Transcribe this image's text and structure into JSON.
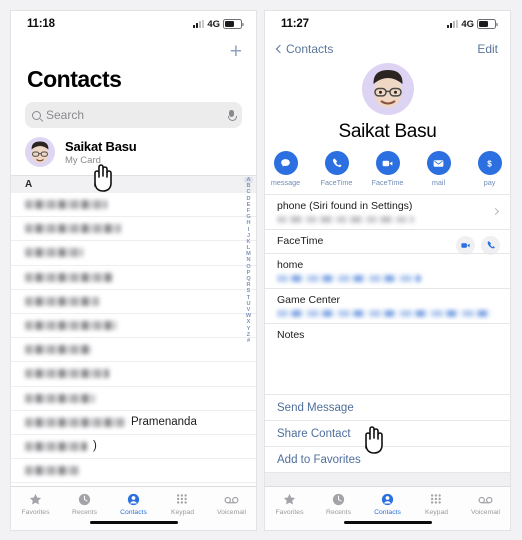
{
  "left": {
    "status": {
      "time": "11:18",
      "network": "4G",
      "signal_icon": "signal-bars-icon",
      "battery_icon": "battery-icon"
    },
    "add_button": "+",
    "title": "Contacts",
    "search": {
      "placeholder": "Search",
      "search_icon": "search-icon",
      "dictation_icon": "microphone-icon"
    },
    "my_card": {
      "name": "Saikat Basu",
      "subtitle": "My Card",
      "avatar_icon": "memoji-avatar"
    },
    "section_header": "A",
    "visible_contact_name": "Pramenanda",
    "redacted_rows": 13,
    "index": [
      "A",
      "B",
      "C",
      "D",
      "E",
      "F",
      "G",
      "H",
      "I",
      "J",
      "K",
      "L",
      "M",
      "N",
      "O",
      "P",
      "Q",
      "R",
      "S",
      "T",
      "U",
      "V",
      "W",
      "X",
      "Y",
      "Z",
      "#"
    ]
  },
  "right": {
    "status": {
      "time": "11:27",
      "network": "4G",
      "signal_icon": "signal-bars-icon",
      "battery_icon": "battery-icon"
    },
    "back_label": "Contacts",
    "back_icon": "chevron-left-icon",
    "edit_label": "Edit",
    "contact_name": "Saikat Basu",
    "avatar_icon": "memoji-avatar",
    "actions": [
      {
        "label": "message",
        "icon": "message-bubble-icon"
      },
      {
        "label": "FaceTime",
        "icon": "phone-icon"
      },
      {
        "label": "FaceTime",
        "icon": "video-camera-icon"
      },
      {
        "label": "mail",
        "icon": "envelope-icon"
      },
      {
        "label": "pay",
        "icon": "dollar-icon"
      }
    ],
    "detail_rows": [
      {
        "key": "phone (Siri found in Settings)",
        "value_style": "gray",
        "chevron": true
      },
      {
        "key": "FaceTime",
        "value_style": "none",
        "buttons": [
          "video-camera-icon",
          "phone-icon"
        ]
      },
      {
        "key": "home",
        "value_style": "blue"
      },
      {
        "key": "Game Center",
        "value_style": "blue"
      },
      {
        "key": "Notes",
        "value_style": "empty"
      }
    ],
    "links": [
      "Send Message",
      "Share Contact",
      "Add to Favorites"
    ]
  },
  "tabs": [
    {
      "label": "Favorites",
      "icon": "star-icon",
      "active": false
    },
    {
      "label": "Recents",
      "icon": "clock-icon",
      "active": false
    },
    {
      "label": "Contacts",
      "icon": "person-circle-icon",
      "active": true
    },
    {
      "label": "Keypad",
      "icon": "keypad-dots-icon",
      "active": false
    },
    {
      "label": "Voicemail",
      "icon": "voicemail-icon",
      "active": false
    }
  ],
  "colors": {
    "accent": "#2b6fe0",
    "link": "#4f6f9c",
    "muted": "#8a8a8e",
    "avatar_bg": "#ddd4f3"
  }
}
